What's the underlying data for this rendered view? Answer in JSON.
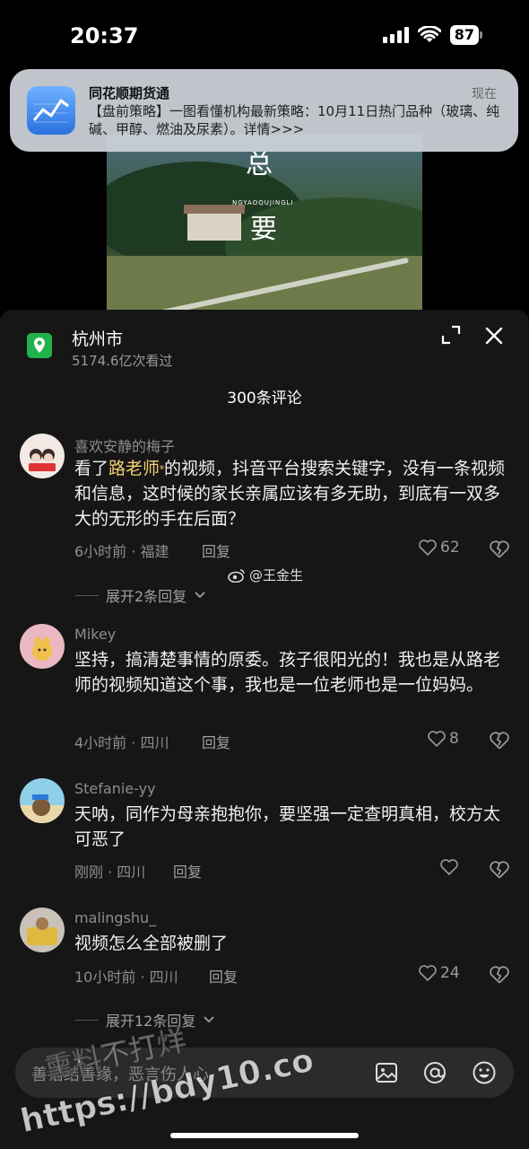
{
  "status": {
    "time": "20:37",
    "battery": "87"
  },
  "notification": {
    "app": "同花顺期货通",
    "time": "现在",
    "body": "【盘前策略】一图看懂机构最新策略：10月11日热门品种（玻璃、纯碱、甲醇、燃油及尿素）。详情>>>"
  },
  "video": {
    "char_top": "总",
    "char_bottom": "要",
    "small_text": "NGYAOQUJINGLI"
  },
  "panel": {
    "location": "杭州市",
    "views": "5174.6亿次看过",
    "comments_count": "300条评论"
  },
  "comments": [
    {
      "user": "喜欢安静的梅子",
      "text_prefix": "看了",
      "text_highlight": "路老师",
      "text_rest": "的视频，抖音平台搜索关键字，没有一条视频和信息，这时候的家长亲属应该有多无助，到底有一双多大的无形的手在后面？",
      "meta": "6小时前 · 福建",
      "reply": "回复",
      "likes": "62",
      "expand": "展开2条回复"
    },
    {
      "user": "Mikey",
      "text": "坚持，搞清楚事情的原委。孩子很阳光的！我也是从路老师的视频知道这个事，我也是一位老师也是一位妈妈。",
      "meta": "4小时前 · 四川",
      "reply": "回复",
      "likes": "8"
    },
    {
      "user": "Stefanie-yy",
      "text": "天呐，同作为母亲抱抱你，要坚强一定查明真相，校方太可恶了",
      "meta": "刚刚 · 四川",
      "reply": "回复",
      "likes": ""
    },
    {
      "user": "malingshu_",
      "text": "视频怎么全部被删了",
      "meta": "10小时前 · 四川",
      "reply": "回复",
      "likes": "24",
      "expand": "展开12条回复"
    }
  ],
  "weibo_watermark": "@王金生",
  "input": {
    "placeholder": "善语结善缘，恶言伤人心"
  },
  "overlay_watermark": {
    "line1": "熏料不打烊",
    "line2": "https://bdy10.co"
  },
  "colors": {
    "panel_bg": "#161616",
    "highlight": "#f4cf74",
    "location_icon": "#22b24c"
  }
}
